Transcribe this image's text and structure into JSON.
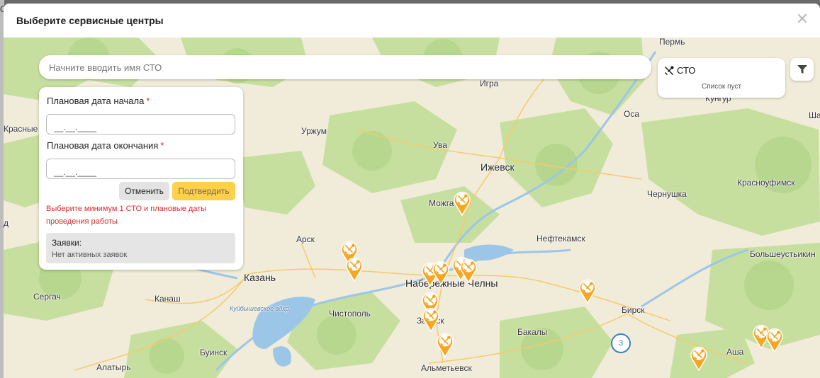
{
  "background": {
    "fragment": "С"
  },
  "modal": {
    "title": "Выберите сервисные центры",
    "close_glyph": "✕"
  },
  "search": {
    "placeholder": "Начните вводить имя СТО"
  },
  "sto_panel": {
    "icon": "tools-icon",
    "title": "СТО",
    "empty": "Список пуст"
  },
  "filter": {
    "icon": "filter-icon"
  },
  "form": {
    "start_label": "Плановая дата начала",
    "end_label": "Плановая дата окончания",
    "required_mark": "*",
    "start_value": "__.__.____",
    "end_value": "__.__.____",
    "cancel_label": "Отменить",
    "confirm_label": "Подтвердить",
    "error": "Выберите минимум 1 СТО и плановые даты проведения работы",
    "orders_title": "Заявки:",
    "orders_empty": "Нет активных заявок"
  },
  "colors": {
    "accent": "#ffd04a",
    "pin": "#f5a623",
    "error": "#d32f2f",
    "cluster": "#3a7fc1"
  },
  "map": {
    "labels": {
      "perm": "Пермь",
      "krasnye": "Красные",
      "urzhum": "Уржум",
      "igra": "Игра",
      "osa": "Оса",
      "kungur": "Кунгур",
      "sha": "Ша",
      "uva": "Ува",
      "izhevsk": "Ижевск",
      "chernushka": "Чернушка",
      "krasnoufimsk": "Красноуфимск",
      "mozhga": "Можга",
      "d": "д",
      "arsk": "Арск",
      "neftekamsk": "Нефтекамск",
      "bolsheustikinskoe": "Большеустьикин",
      "kazan": "Казань",
      "chelny": "Набережные Челны",
      "sergach": "Сергач",
      "kanash": "Канаш",
      "reservoir": "Куйбышевское вдхр.",
      "chistopol": "Чистополь",
      "birsk": "Бирск",
      "zainsk": "Заинск",
      "bakaly": "Бакалы",
      "buinsk": "Буинск",
      "asha": "Аша",
      "alatyr": "Алатырь",
      "almetyevsk": "Альметьевск"
    },
    "cluster_count": "3"
  }
}
